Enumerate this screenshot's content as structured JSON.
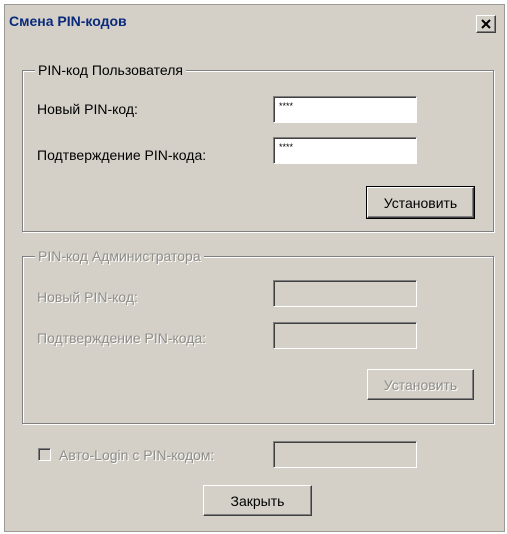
{
  "window": {
    "title": "Смена PIN-кодов",
    "close_glyph": "×"
  },
  "user_group": {
    "legend": "PIN-код Пользователя",
    "new_pin_label": "Новый PIN-код:",
    "new_pin_value": "****",
    "confirm_label": "Подтверждение PIN-кода:",
    "confirm_value": "****",
    "set_button": "Установить"
  },
  "admin_group": {
    "legend": "PIN-код Администратора",
    "new_pin_label": "Новый PIN-код:",
    "new_pin_value": "",
    "confirm_label": "Подтверждение PIN-кода:",
    "confirm_value": "",
    "set_button": "Установить"
  },
  "auto_login": {
    "label": "Авто-Login с PIN-кодом:",
    "checked": false,
    "value": ""
  },
  "close_button": "Закрыть"
}
